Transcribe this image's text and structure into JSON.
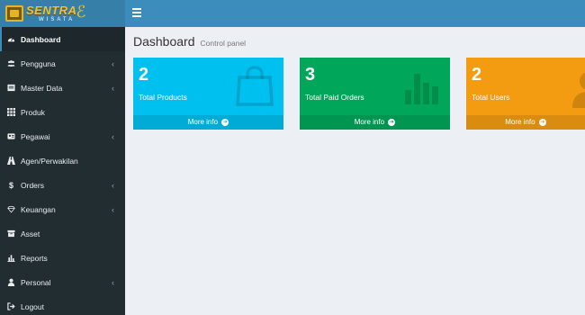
{
  "logo": {
    "main": "SENTRA",
    "sub": "WISATA"
  },
  "sidebar": {
    "items": [
      {
        "label": "Dashboard",
        "icon": "dashboard-icon",
        "active": true,
        "chevron": false
      },
      {
        "label": "Pengguna",
        "icon": "users-icon",
        "active": false,
        "chevron": true
      },
      {
        "label": "Master Data",
        "icon": "master-data-icon",
        "active": false,
        "chevron": true
      },
      {
        "label": "Produk",
        "icon": "grid-icon",
        "active": false,
        "chevron": false
      },
      {
        "label": "Pegawai",
        "icon": "id-card-icon",
        "active": false,
        "chevron": true
      },
      {
        "label": "Agen/Perwakilan",
        "icon": "road-icon",
        "active": false,
        "chevron": false
      },
      {
        "label": "Orders",
        "icon": "dollar-icon",
        "active": false,
        "chevron": true
      },
      {
        "label": "Keuangan",
        "icon": "diamond-icon",
        "active": false,
        "chevron": true
      },
      {
        "label": "Asset",
        "icon": "archive-icon",
        "active": false,
        "chevron": false
      },
      {
        "label": "Reports",
        "icon": "bar-chart-icon",
        "active": false,
        "chevron": false
      },
      {
        "label": "Personal",
        "icon": "user-icon",
        "active": false,
        "chevron": true
      },
      {
        "label": "Logout",
        "icon": "sign-out-icon",
        "active": false,
        "chevron": false
      }
    ]
  },
  "content": {
    "title": "Dashboard",
    "subtitle": "Control panel"
  },
  "boxes": [
    {
      "value": "2",
      "label": "Total Products",
      "footer": "More info",
      "color": "#00c0ef",
      "icon": "shopping-bag-icon"
    },
    {
      "value": "3",
      "label": "Total Paid Orders",
      "footer": "More info",
      "color": "#00a65a",
      "icon": "bar-chart-icon"
    },
    {
      "value": "2",
      "label": "Total Users",
      "footer": "More info",
      "color": "#f39c12",
      "icon": "user-icon"
    }
  ],
  "colors": {
    "header": "#3c8dbc",
    "logo_bg": "#367fa9",
    "sidebar": "#222d32",
    "content_bg": "#ecf0f5"
  }
}
